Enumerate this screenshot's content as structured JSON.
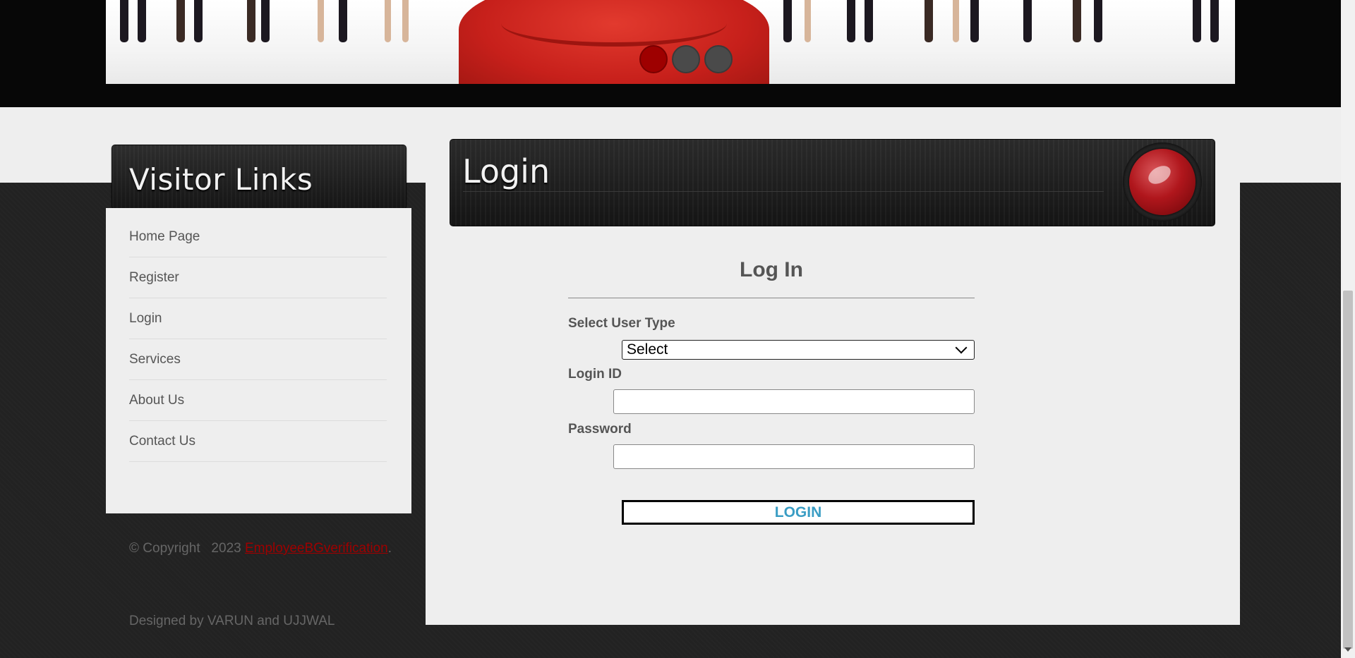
{
  "slider": {
    "dots": 3,
    "active": 1
  },
  "sidebar": {
    "title": "Visitor Links",
    "items": [
      {
        "label": "Home Page"
      },
      {
        "label": "Register"
      },
      {
        "label": "Login"
      },
      {
        "label": "Services"
      },
      {
        "label": "About Us"
      },
      {
        "label": "Contact Us"
      }
    ]
  },
  "footer": {
    "copyright_prefix": "© Copyright   2023",
    "site_link": "EmployeeBGverification",
    "copyright_suffix": ".",
    "designed_by": "Designed by VARUN and UJJWAL"
  },
  "panel": {
    "title": "Login"
  },
  "form": {
    "title": "Log In",
    "user_type_label": "Select User Type",
    "user_type_value": "Select",
    "login_id_label": "Login ID",
    "login_id_value": "",
    "password_label": "Password",
    "password_value": "",
    "submit_label": "LOGIN"
  },
  "colors": {
    "accent_red": "#9e0000",
    "button_text": "#3a9dc4",
    "dark_band": "#222222"
  }
}
